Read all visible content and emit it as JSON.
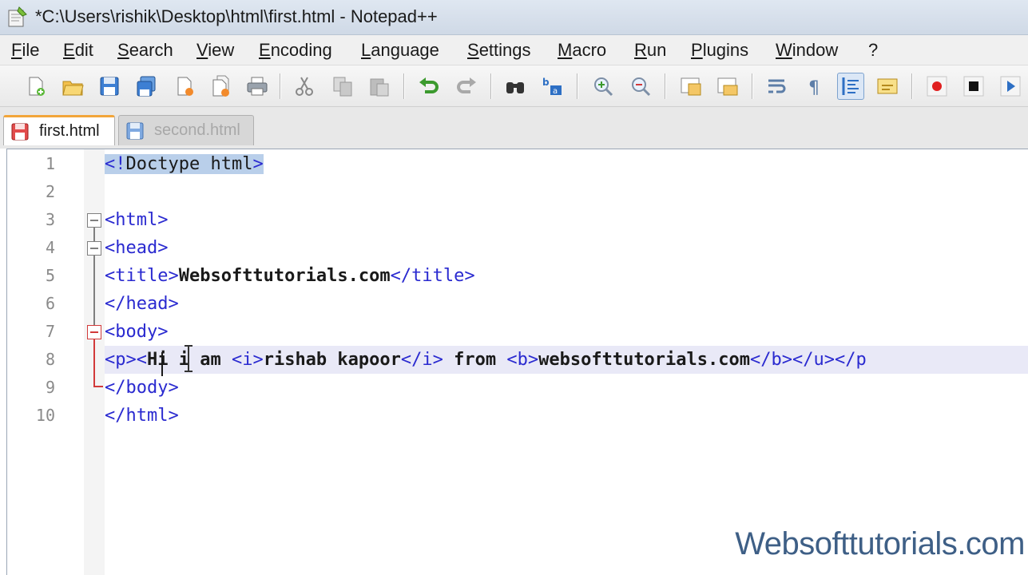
{
  "window": {
    "title": "*C:\\Users\\rishik\\Desktop\\html\\first.html - Notepad++"
  },
  "menu": {
    "items": [
      "File",
      "Edit",
      "Search",
      "View",
      "Encoding",
      "Language",
      "Settings",
      "Macro",
      "Run",
      "Plugins",
      "Window",
      "?"
    ]
  },
  "toolbar": {
    "buttons": [
      "new-file-icon",
      "open-file-icon",
      "save-icon",
      "save-all-icon",
      "close-icon",
      "close-all-icon",
      "print-icon",
      "cut-icon",
      "copy-icon",
      "paste-icon",
      "undo-icon",
      "redo-icon",
      "find-icon",
      "replace-icon",
      "zoom-in-icon",
      "zoom-out-icon",
      "sync-vertical-icon",
      "sync-horizontal-icon",
      "word-wrap-icon",
      "show-all-chars-icon",
      "indent-guide-icon",
      "user-lang-icon",
      "record-macro-icon",
      "stop-macro-icon",
      "play-macro-icon"
    ]
  },
  "tabs": [
    {
      "label": "first.html",
      "active": true
    },
    {
      "label": "second.html",
      "active": false
    }
  ],
  "editor": {
    "line_numbers": [
      "1",
      "2",
      "3",
      "4",
      "5",
      "6",
      "7",
      "8",
      "9",
      "10"
    ],
    "lines": {
      "l1": {
        "open": "<!",
        "word": "Doctype html",
        "close": ">"
      },
      "l3": "<html>",
      "l4": "<head>",
      "l5": {
        "open": "<title>",
        "text": "Websofttutorials.com",
        "close": "</title>"
      },
      "l6": "</head>",
      "l7": "<body>",
      "l8": {
        "t1": "<p><",
        "t2": "Hi i am ",
        "t3": "<i>",
        "t4": "rishab kapoor",
        "t5": "</i>",
        "t6": " from ",
        "t7": "<b>",
        "t8": "websofttutorials.com",
        "t9": "</b></u></p"
      },
      "l9": "</body>",
      "l10": "</html>"
    }
  },
  "watermark": "Websofttutorials.com",
  "colors": {
    "tag": "#2a2ad0",
    "active_tab_accent": "#f2a53a",
    "current_line": "#e9e9f7",
    "watermark": "#3e5f86"
  }
}
